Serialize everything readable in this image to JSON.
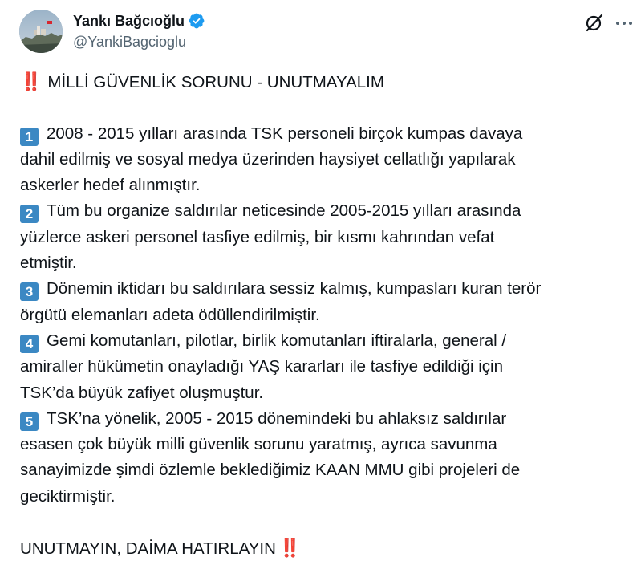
{
  "author": {
    "display_name": "Yankı Bağcıoğlu",
    "handle": "@YankiBagcioglu",
    "verified": true
  },
  "icons": {
    "verified": "verified-badge-icon",
    "grok": "grok-icon",
    "more": "more-options-icon"
  },
  "colors": {
    "text": "#0f1419",
    "secondary_text": "#536471",
    "verified_blue": "#1d9bf0",
    "number_badge": "#3b88c3",
    "exclamation_red": "#d7262e"
  },
  "tweet": {
    "title": "MİLLİ GÜVENLİK SORUNU - UNUTMAYALIM",
    "title_emoji": "‼️",
    "items": [
      {
        "number": "1",
        "lines": [
          "2008 - 2015 yılları arasında TSK personeli birçok kumpas davaya",
          "dahil edilmiş ve sosyal medya üzerinden haysiyet cellatlığı yapılarak",
          "askerler hedef alınmıştır."
        ]
      },
      {
        "number": "2",
        "lines": [
          "Tüm bu organize saldırılar neticesinde 2005-2015 yılları arasında",
          "yüzlerce askeri personel tasfiye edilmiş, bir kısmı kahrından vefat",
          "etmiştir."
        ]
      },
      {
        "number": "3",
        "lines": [
          "Dönemin iktidarı bu saldırılara sessiz kalmış, kumpasları kuran terör",
          "örgütü elemanları adeta ödüllendirilmiştir."
        ]
      },
      {
        "number": "4",
        "lines": [
          "Gemi komutanları, pilotlar, birlik komutanları iftiralarla, general /",
          "amiraller hükümetin onayladığı YAŞ kararları ile tasfiye edildiği için",
          "TSK’da büyük zafiyet oluşmuştur."
        ]
      },
      {
        "number": "5",
        "lines": [
          "TSK’na yönelik, 2005 - 2015 dönemindeki bu ahlaksız saldırılar",
          "esasen çok büyük milli güvenlik sorunu yaratmış, ayrıca savunma",
          "sanayimizde şimdi özlemle beklediğimiz KAAN MMU gibi projeleri de",
          "geciktirmiştir."
        ]
      }
    ],
    "closing": "UNUTMAYIN, DAİMA HATIRLAYIN",
    "closing_emoji": "‼️"
  }
}
